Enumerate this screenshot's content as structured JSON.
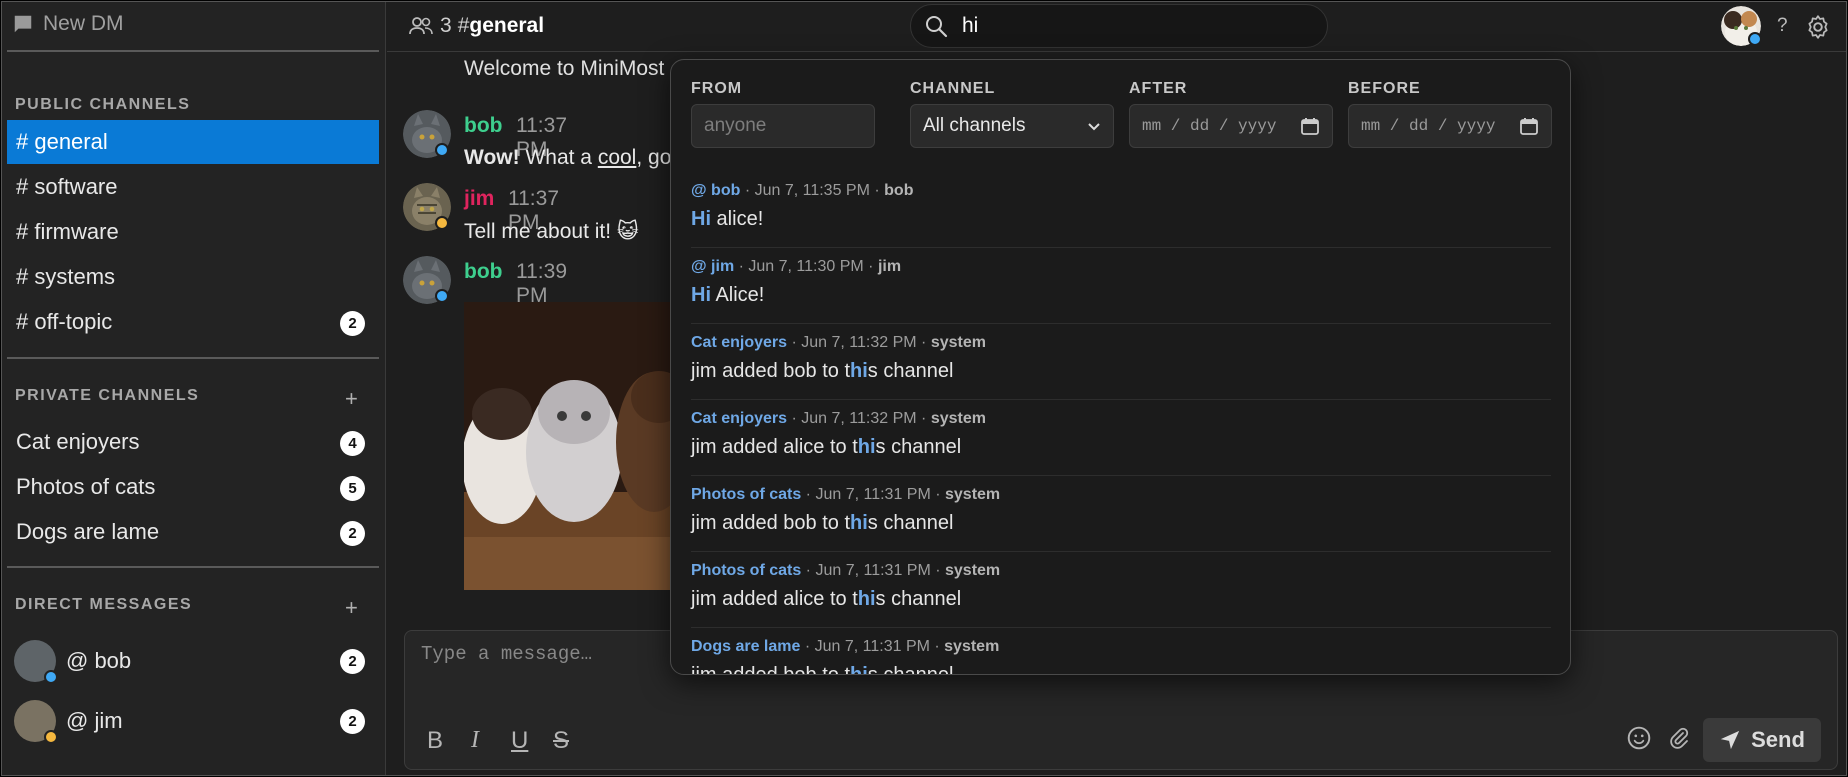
{
  "sidebar": {
    "new_dm_label": "New DM",
    "public_title": "PUBLIC CHANNELS",
    "private_title": "PRIVATE CHANNELS",
    "dm_title": "DIRECT MESSAGES",
    "plus": "+",
    "public_channels": [
      {
        "label": "# general",
        "active": true,
        "badge": ""
      },
      {
        "label": "# software",
        "badge": ""
      },
      {
        "label": "# firmware",
        "badge": ""
      },
      {
        "label": "# systems",
        "badge": ""
      },
      {
        "label": "# off-topic",
        "badge": "2"
      }
    ],
    "private_channels": [
      {
        "label": "Cat enjoyers",
        "badge": "4"
      },
      {
        "label": "Photos of cats",
        "badge": "5"
      },
      {
        "label": "Dogs are lame",
        "badge": "2"
      }
    ],
    "direct_messages": [
      {
        "label": "@ bob",
        "badge": "2",
        "status_color": "#3fa9f5"
      },
      {
        "label": "@ jim",
        "badge": "2",
        "status_color": "#f5b83f"
      }
    ]
  },
  "header": {
    "member_count": "3",
    "channel_hash": "#",
    "channel_name": "general",
    "search_value": "hi",
    "help": "?"
  },
  "messages": {
    "welcome": "Welcome to MiniMost",
    "items": [
      {
        "author": "bob",
        "author_color": "#3ecf8e",
        "time": "11:37 PM",
        "text_bold": "Wow!",
        "text_rest": " What a ",
        "text_link": "cool",
        "text_tail": ", go"
      },
      {
        "author": "jim",
        "author_color": "#e0245e",
        "time": "11:37 PM",
        "text": "Tell me about it! 😺"
      },
      {
        "author": "bob",
        "author_color": "#3ecf8e",
        "time": "11:39 PM"
      }
    ]
  },
  "composer": {
    "placeholder": "Type a message…",
    "bold": "B",
    "italic": "I",
    "underline": "U",
    "strike": "S",
    "send_label": "Send"
  },
  "search_popup": {
    "from_label": "FROM",
    "from_placeholder": "anyone",
    "channel_label": "CHANNEL",
    "channel_value": "All channels",
    "after_label": "AFTER",
    "before_label": "BEFORE",
    "date_placeholder": "mm / dd / yyyy",
    "results": [
      {
        "source": "@ bob",
        "date": "Jun 7, 11:35 PM",
        "who": "bob",
        "pre": "",
        "hl": "Hi",
        "post": " alice!"
      },
      {
        "source": "@ jim",
        "date": "Jun 7, 11:30 PM",
        "who": "jim",
        "pre": "",
        "hl": "Hi",
        "post": " Alice!"
      },
      {
        "source": "Cat enjoyers",
        "date": "Jun 7, 11:32 PM",
        "who": "system",
        "pre": "jim added bob to t",
        "hl": "hi",
        "post": "s channel"
      },
      {
        "source": "Cat enjoyers",
        "date": "Jun 7, 11:32 PM",
        "who": "system",
        "pre": "jim added alice to t",
        "hl": "hi",
        "post": "s channel"
      },
      {
        "source": "Photos of cats",
        "date": "Jun 7, 11:31 PM",
        "who": "system",
        "pre": "jim added bob to t",
        "hl": "hi",
        "post": "s channel"
      },
      {
        "source": "Photos of cats",
        "date": "Jun 7, 11:31 PM",
        "who": "system",
        "pre": "jim added alice to t",
        "hl": "hi",
        "post": "s channel"
      },
      {
        "source": "Dogs are lame",
        "date": "Jun 7, 11:31 PM",
        "who": "system",
        "pre": "jim added bob to t",
        "hl": "hi",
        "post": "s channel"
      }
    ]
  },
  "colors": {
    "accent": "#0a7ad6",
    "link": "#6fa8e6",
    "online": "#3fa9f5",
    "away": "#f5b83f"
  }
}
